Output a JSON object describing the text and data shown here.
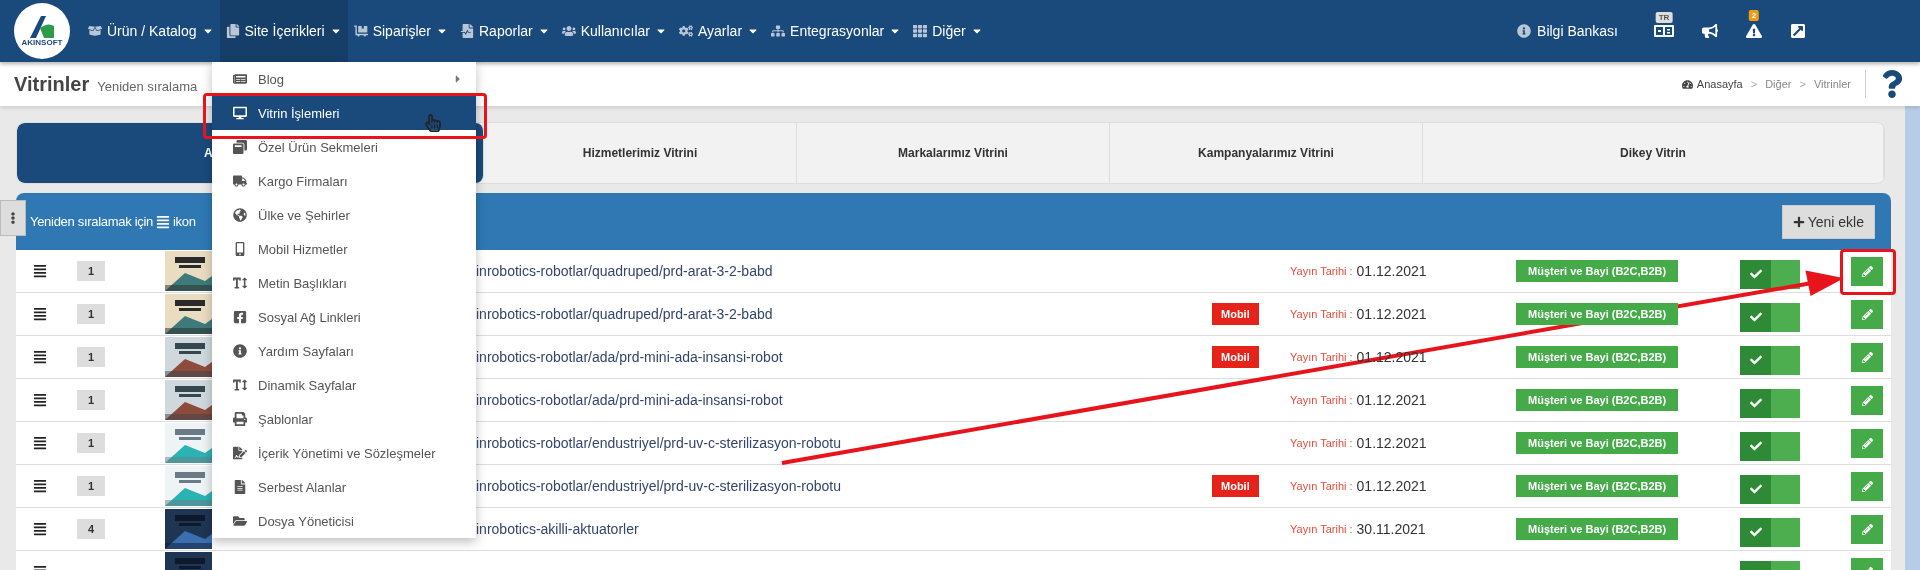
{
  "brand": {
    "logo_text": "AKINSOFT"
  },
  "nav": {
    "items": [
      {
        "label": "Ürün / Katalog",
        "selected": false
      },
      {
        "label": "Site İçerikleri",
        "selected": true
      },
      {
        "label": "Siparişler",
        "selected": false
      },
      {
        "label": "Raporlar",
        "selected": false
      },
      {
        "label": "Kullanıcılar",
        "selected": false
      },
      {
        "label": "Ayarlar",
        "selected": false
      },
      {
        "label": "Entegrasyonlar",
        "selected": false
      },
      {
        "label": "Diğer",
        "selected": false
      }
    ],
    "help_link": "Bilgi Bankası",
    "language_badge": "TR",
    "alerts_badge": "2"
  },
  "page_header": {
    "title": "Vitrinler",
    "subtitle": "Yeniden sıralama",
    "breadcrumb": [
      "Anasayfa",
      "Diğer",
      "Vitrinler"
    ],
    "separator": ">"
  },
  "dropdown": {
    "items": [
      {
        "label": "Blog",
        "selected": false,
        "submenu": true
      },
      {
        "label": "Vitrin İşlemleri",
        "selected": true,
        "submenu": false
      },
      {
        "label": "Özel Ürün Sekmeleri",
        "selected": false,
        "submenu": false
      },
      {
        "label": "Kargo Firmaları",
        "selected": false,
        "submenu": false
      },
      {
        "label": "Ülke ve Şehirler",
        "selected": false,
        "submenu": false
      },
      {
        "label": "Mobil Hizmetler",
        "selected": false,
        "submenu": false
      },
      {
        "label": "Metin Başlıkları",
        "selected": false,
        "submenu": false
      },
      {
        "label": "Sosyal Ağ Linkleri",
        "selected": false,
        "submenu": false
      },
      {
        "label": "Yardım Sayfaları",
        "selected": false,
        "submenu": false
      },
      {
        "label": "Dinamik Sayfalar",
        "selected": false,
        "submenu": false
      },
      {
        "label": "Şablonlar",
        "selected": false,
        "submenu": false
      },
      {
        "label": "İçerik Yönetimi ve Sözleşmeler",
        "selected": false,
        "submenu": false
      },
      {
        "label": "Serbest Alanlar",
        "selected": false,
        "submenu": false
      },
      {
        "label": "Dosya Yöneticisi",
        "selected": false,
        "submenu": false
      }
    ]
  },
  "tabs": [
    {
      "label": "A",
      "selected": true
    },
    {
      "label": "Hizmetlerimiz Vitrini",
      "selected": false
    },
    {
      "label": "Markalarımız Vitrini",
      "selected": false
    },
    {
      "label": "Kampanyalarımız Vitrini",
      "selected": false
    },
    {
      "label": "Dikey Vitrin",
      "selected": false
    }
  ],
  "panel": {
    "hint_before": "Yeniden sıralamak için",
    "hint_after": "ikon",
    "add_button": "Yeni ekle"
  },
  "rows": [
    {
      "order": "1",
      "url": "inrobotics-robotlar/quadruped/prd-arat-3-2-babd",
      "date_label": "Yayın Tarihi :",
      "date": "01.12.2021",
      "audience": "Müşteri ve Bayi (B2C,B2B)",
      "active": true
    },
    {
      "order": "1",
      "url": "inrobotics-robotlar/quadruped/prd-arat-3-2-babd",
      "mobile_tag": "Mobil",
      "date_label": "Yayın Tarihi :",
      "date": "01.12.2021",
      "audience": "Müşteri ve Bayi (B2C,B2B)",
      "active": true
    },
    {
      "order": "1",
      "url": "inrobotics-robotlar/ada/prd-mini-ada-insansi-robot",
      "mobile_tag": "Mobil",
      "date_label": "Yayın Tarihi :",
      "date": "01.12.2021",
      "audience": "Müşteri ve Bayi (B2C,B2B)",
      "active": true
    },
    {
      "order": "1",
      "url": "inrobotics-robotlar/ada/prd-mini-ada-insansi-robot",
      "date_label": "Yayın Tarihi :",
      "date": "01.12.2021",
      "audience": "Müşteri ve Bayi (B2C,B2B)",
      "active": true
    },
    {
      "order": "1",
      "url": "inrobotics-robotlar/endustriyel/prd-uv-c-sterilizasyon-robotu",
      "date_label": "Yayın Tarihi :",
      "date": "01.12.2021",
      "audience": "Müşteri ve Bayi (B2C,B2B)",
      "active": true
    },
    {
      "order": "1",
      "url": "inrobotics-robotlar/endustriyel/prd-uv-c-sterilizasyon-robotu",
      "mobile_tag": "Mobil",
      "date_label": "Yayın Tarihi :",
      "date": "01.12.2021",
      "audience": "Müşteri ve Bayi (B2C,B2B)",
      "active": true
    },
    {
      "order": "4",
      "url": "inrobotics-akilli-aktuatorler",
      "date_label": "Yayın Tarihi :",
      "date": "30.11.2021",
      "audience": "Müşteri ve Bayi (B2C,B2B)",
      "active": true
    },
    {
      "active": true
    }
  ]
}
